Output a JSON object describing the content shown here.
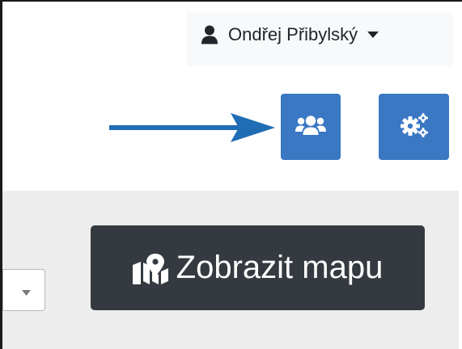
{
  "user_menu": {
    "name": "Ondřej Přibylský",
    "icon": "user-icon",
    "caret_icon": "caret-down-icon"
  },
  "header_buttons": [
    {
      "icon": "users-icon",
      "color": "#3a78c3"
    },
    {
      "icon": "cogs-icon",
      "color": "#3a78c3"
    }
  ],
  "annotation": {
    "icon": "arrow-right-icon",
    "color": "#1f6db5",
    "points_to": "users-button"
  },
  "toolbar": {
    "select": {
      "icon": "caret-down-icon"
    },
    "map_button": {
      "label": "Zobrazit mapu",
      "icon": "map-marked-icon",
      "color": "#343a40"
    }
  }
}
